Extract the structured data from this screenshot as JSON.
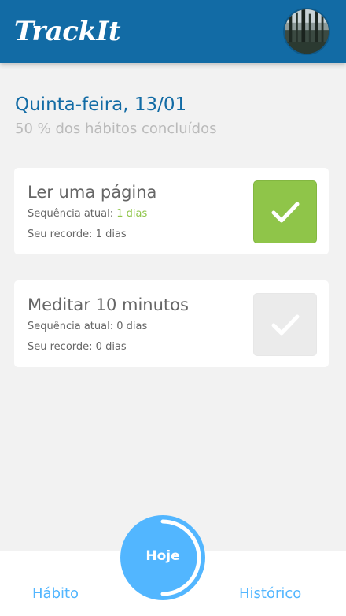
{
  "header": {
    "logo": "TrackIt",
    "avatar_icon": "user-avatar"
  },
  "today": {
    "title": "Quinta-feira, 13/01",
    "subtitle": "50 % dos hábitos concluídos",
    "progress": 0.5
  },
  "habits": [
    {
      "name": "Ler uma página",
      "streak_label": "Sequência atual: ",
      "streak_value": "1 dias",
      "record_label": "Seu recorde: ",
      "record_value": "1 dias",
      "done": true
    },
    {
      "name": "Meditar 10 minutos",
      "streak_label": "Sequência atual: ",
      "streak_value": "0 dias",
      "record_label": "Seu recorde: ",
      "record_value": "0 dias",
      "done": false
    }
  ],
  "footer": {
    "left": "Hábito",
    "center": "Hoje",
    "right": "Histórico"
  },
  "colors": {
    "header_bg": "#126ba5",
    "accent": "#52b6ff",
    "done_green": "#8fc549",
    "todo_gray": "#ebebeb"
  }
}
